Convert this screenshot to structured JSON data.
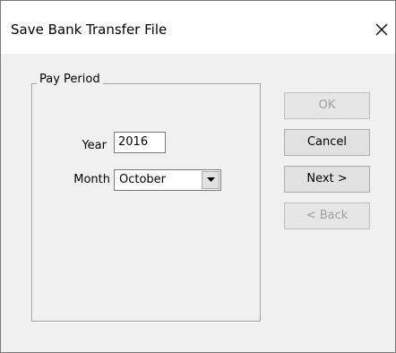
{
  "window": {
    "title": "Save Bank Transfer File"
  },
  "group": {
    "legend": "Pay Period"
  },
  "fields": {
    "year_label": "Year",
    "year_value": "2016",
    "month_label": "Month",
    "month_value": "October"
  },
  "buttons": {
    "ok": "OK",
    "cancel": "Cancel",
    "next": "Next >",
    "back": "< Back"
  },
  "icons": {
    "close": "close-icon",
    "dropdown": "chevron-down-icon"
  }
}
